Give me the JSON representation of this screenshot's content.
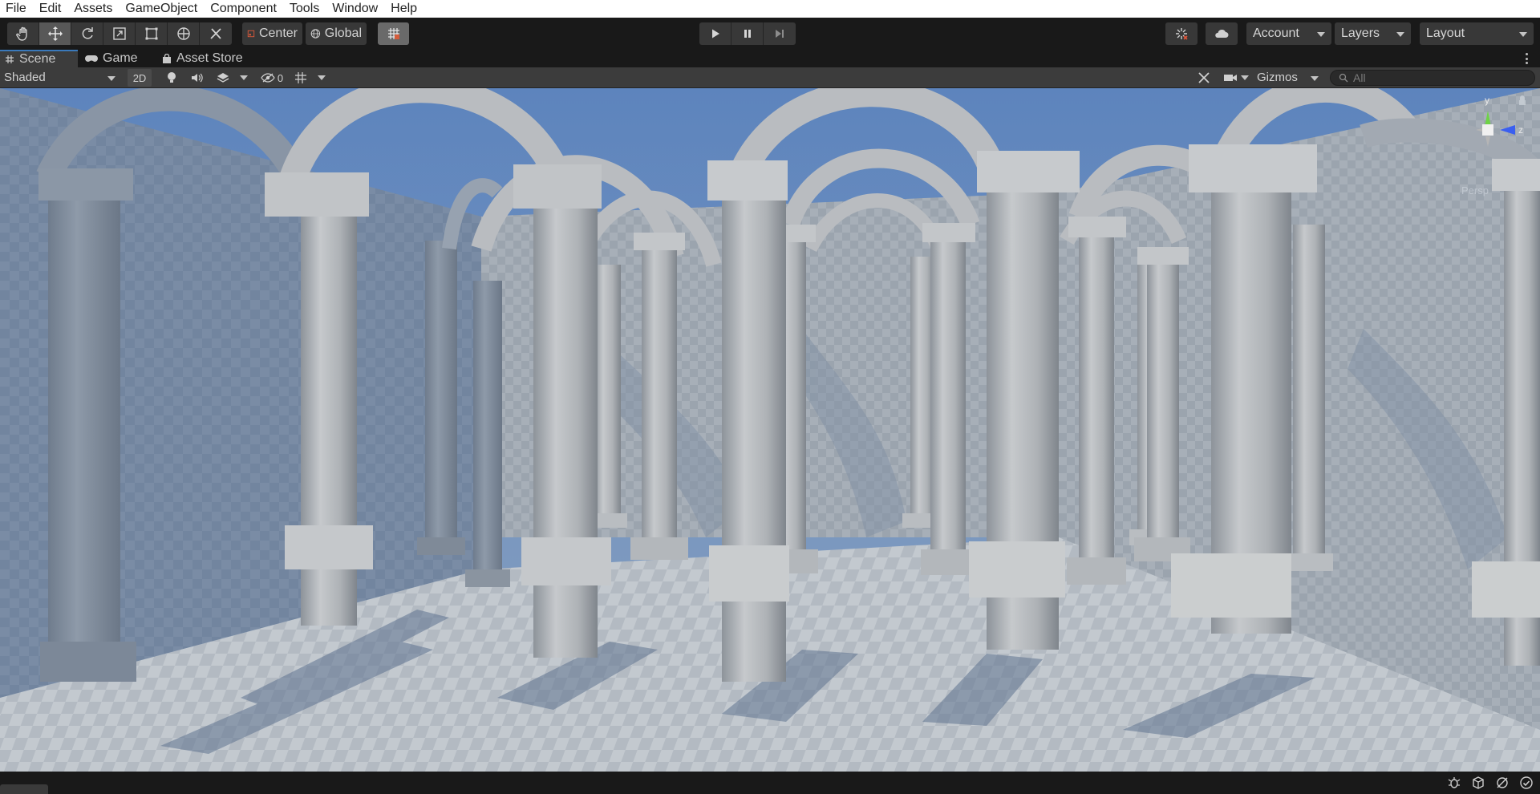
{
  "menu": {
    "items": [
      "File",
      "Edit",
      "Assets",
      "GameObject",
      "Component",
      "Tools",
      "Window",
      "Help"
    ]
  },
  "toolbar": {
    "tools": [
      "hand-tool",
      "move-tool",
      "rotate-tool",
      "scale-tool",
      "rect-tool",
      "transform-tool",
      "custom-tool"
    ],
    "active_tool": "move-tool",
    "pivot_label": "Center",
    "space_label": "Global",
    "account_label": "Account",
    "layers_label": "Layers",
    "layout_label": "Layout"
  },
  "tabs": {
    "scene": "Scene",
    "game": "Game",
    "asset_store": "Asset Store",
    "active": "Scene"
  },
  "scene_toolbar": {
    "shading_mode": "Shaded",
    "mode_2d": "2D",
    "hidden_count": "0",
    "gizmos_label": "Gizmos",
    "search_placeholder": "All"
  },
  "gizmo": {
    "y_label": "y",
    "z_label": "z",
    "projection_label": "Persp"
  },
  "colors": {
    "accent": "#3a79bb",
    "sky": "#6b8fc2",
    "floor": "#a9b1bb",
    "stone": "#b6b9bd"
  }
}
